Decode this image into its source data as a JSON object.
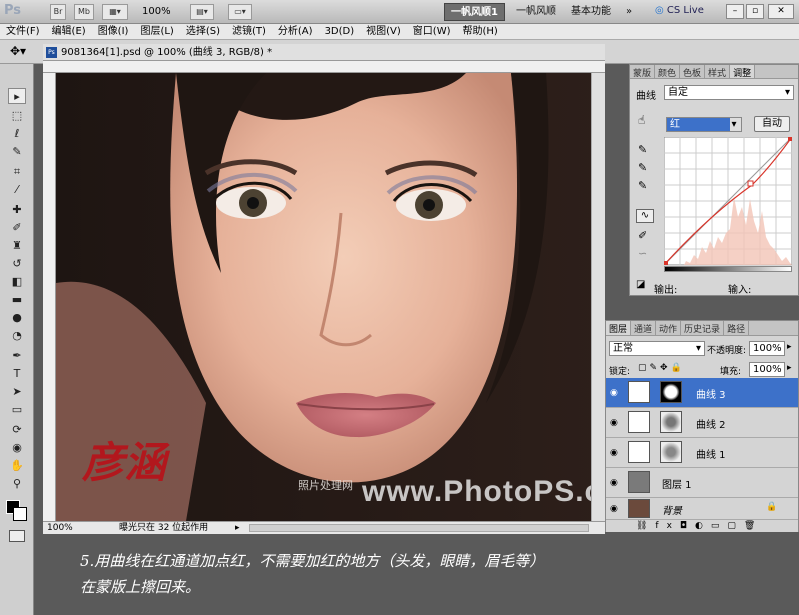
{
  "appbar": {
    "logo": "Ps",
    "br_label": "Br",
    "mb_label": "Mb",
    "zoom": "100%",
    "workspaces": [
      "一帆风顺1",
      "一帆风顺",
      "基本功能"
    ],
    "more": "»",
    "cs_live": "CS Live"
  },
  "menu": [
    "文件(F)",
    "编辑(E)",
    "图像(I)",
    "图层(L)",
    "选择(S)",
    "滤镜(T)",
    "分析(A)",
    "3D(D)",
    "视图(V)",
    "窗口(W)",
    "帮助(H)"
  ],
  "document": {
    "title": "9081364[1].psd @ 100% (曲线 3, RGB/8) *",
    "zoom": "100%",
    "status": "曝光只在 32 位起作用",
    "watermark_cn": "照片处理网",
    "watermark_site": "www.PhotoPS.com",
    "signature": "彦涵"
  },
  "adjustments": {
    "tabs": [
      "蒙版",
      "颜色",
      "色板",
      "样式",
      "调整"
    ],
    "active_tab": "调整",
    "title": "曲线",
    "preset": "自定",
    "channel": "红",
    "auto_button": "自动",
    "output_label": "输出:",
    "input_label": "输入:"
  },
  "layers": {
    "tabs": [
      "图层",
      "通道",
      "动作",
      "历史记录",
      "路径"
    ],
    "blend_mode": "正常",
    "opacity_label": "不透明度:",
    "opacity": "100%",
    "lock_label": "锁定:",
    "fill_label": "填充:",
    "fill": "100%",
    "items": [
      {
        "name": "曲线 3",
        "selected": true
      },
      {
        "name": "曲线 2",
        "selected": false
      },
      {
        "name": "曲线 1",
        "selected": false
      },
      {
        "name": "图层 1",
        "selected": false
      },
      {
        "name": "背景",
        "selected": false
      }
    ]
  },
  "caption": {
    "line1": "5.用曲线在红通道加点红，不需要加红的地方（头发，眼睛，眉毛等）",
    "line2": "在蒙版上擦回来。"
  },
  "colors": {
    "accent": "#3d71c9",
    "curve": "#d9352b"
  }
}
